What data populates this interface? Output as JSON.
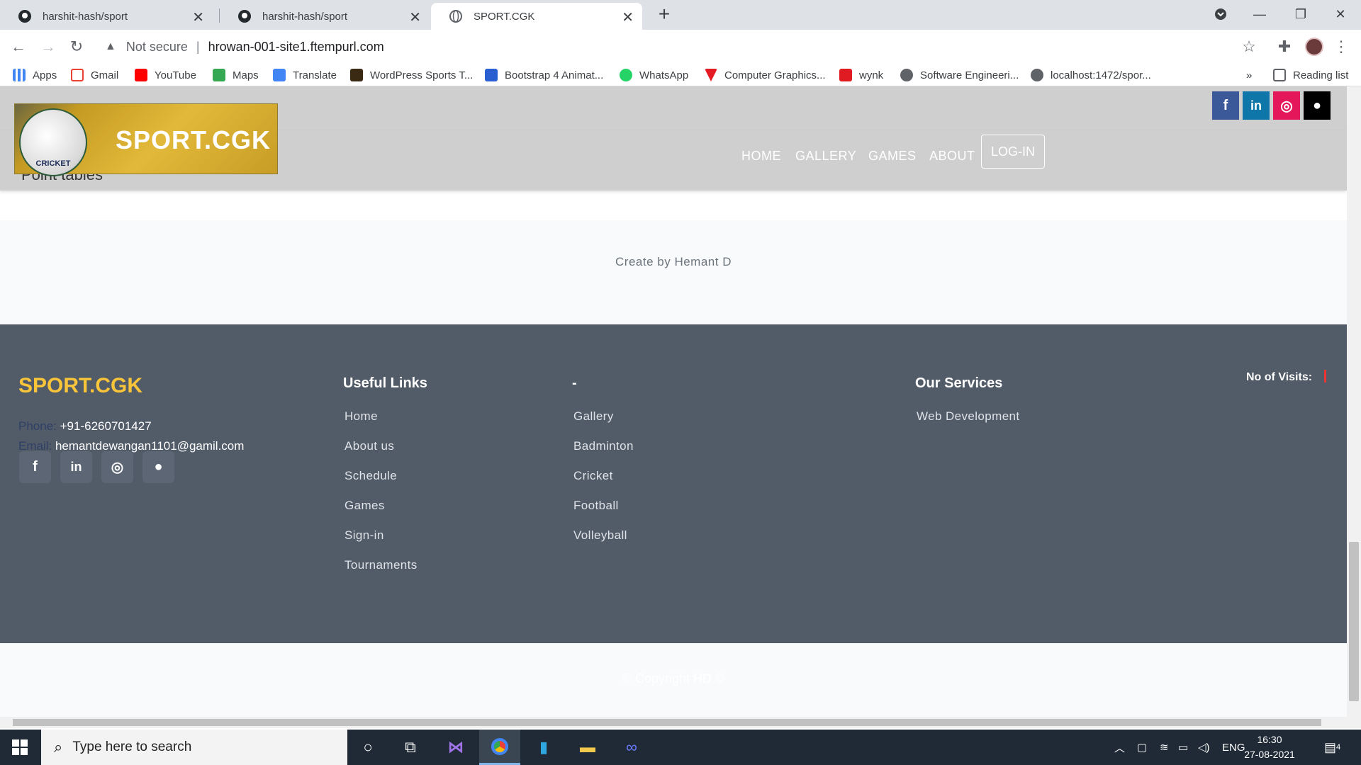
{
  "browser": {
    "tabs": [
      {
        "title": "harshit-hash/sport",
        "icon": "github-icon",
        "active": false
      },
      {
        "title": "harshit-hash/sport",
        "icon": "github-icon",
        "active": false
      },
      {
        "title": "SPORT.CGK",
        "icon": "globe-icon",
        "active": true
      }
    ],
    "security_label": "Not secure",
    "url": "hrowan-001-site1.ftempurl.com",
    "bookmarks": [
      {
        "label": "Apps",
        "icon": "apps-grid-icon"
      },
      {
        "label": "Gmail",
        "icon": "gmail-icon"
      },
      {
        "label": "YouTube",
        "icon": "youtube-icon"
      },
      {
        "label": "Maps",
        "icon": "maps-icon"
      },
      {
        "label": "Translate",
        "icon": "translate-icon"
      },
      {
        "label": "WordPress Sports T...",
        "icon": "wordpress-icon"
      },
      {
        "label": "Bootstrap 4 Animat...",
        "icon": "bootstrap-icon"
      },
      {
        "label": "WhatsApp",
        "icon": "whatsapp-icon"
      },
      {
        "label": "Computer Graphics...",
        "icon": "graphics-icon"
      },
      {
        "label": "wynk",
        "icon": "wynk-icon"
      },
      {
        "label": "Software Engineeri...",
        "icon": "globe-icon"
      },
      {
        "label": "localhost:1472/spor...",
        "icon": "globe-icon"
      }
    ],
    "more_bookmarks": "»",
    "reading_list": "Reading list"
  },
  "site": {
    "logo_text": "SPORT.CGK",
    "logo_badge": "CRICKET",
    "partial_heading": "Point tables",
    "nav": [
      "HOME",
      "GALLERY",
      "GAMES",
      "ABOUT"
    ],
    "login": "LOG-IN",
    "social": [
      {
        "name": "facebook-icon",
        "glyph": "f",
        "color": "#3b5998"
      },
      {
        "name": "linkedin-icon",
        "glyph": "in",
        "color": "#0e76a8"
      },
      {
        "name": "instagram-icon",
        "glyph": "◎",
        "color": "#e4175a"
      },
      {
        "name": "github-icon",
        "glyph": "●",
        "color": "#000000"
      }
    ],
    "credit": "Create by Hemant D"
  },
  "footer": {
    "brand": "SPORT.CGK",
    "phone_label": "Phone:",
    "phone": "+91-6260701427",
    "email_label": "Email:",
    "email": "hemantdewangan1101@gamil.com",
    "social": [
      {
        "name": "facebook-icon",
        "glyph": "f"
      },
      {
        "name": "linkedin-icon",
        "glyph": "in"
      },
      {
        "name": "instagram-icon",
        "glyph": "◎"
      },
      {
        "name": "github-icon",
        "glyph": "●"
      }
    ],
    "useful_links_title": "Useful Links",
    "useful_links": [
      "Home",
      "About us",
      "Schedule",
      "Games",
      "Sign-in",
      "Tournaments"
    ],
    "second_title": "-",
    "second_links": [
      "Gallery",
      "Badminton",
      "Cricket",
      "Football",
      "Volleyball"
    ],
    "services_title": "Our Services",
    "services": [
      "Web Development"
    ],
    "visits_label": "No of Visits:",
    "copyright_prefix": "© Copyright ",
    "copyright_bold": "HD",
    "copyright_suffix": " ©"
  },
  "taskbar": {
    "search_placeholder": "Type here to search",
    "language": "ENG",
    "time": "16:30",
    "date": "27-08-2021",
    "notification_count": "4"
  }
}
